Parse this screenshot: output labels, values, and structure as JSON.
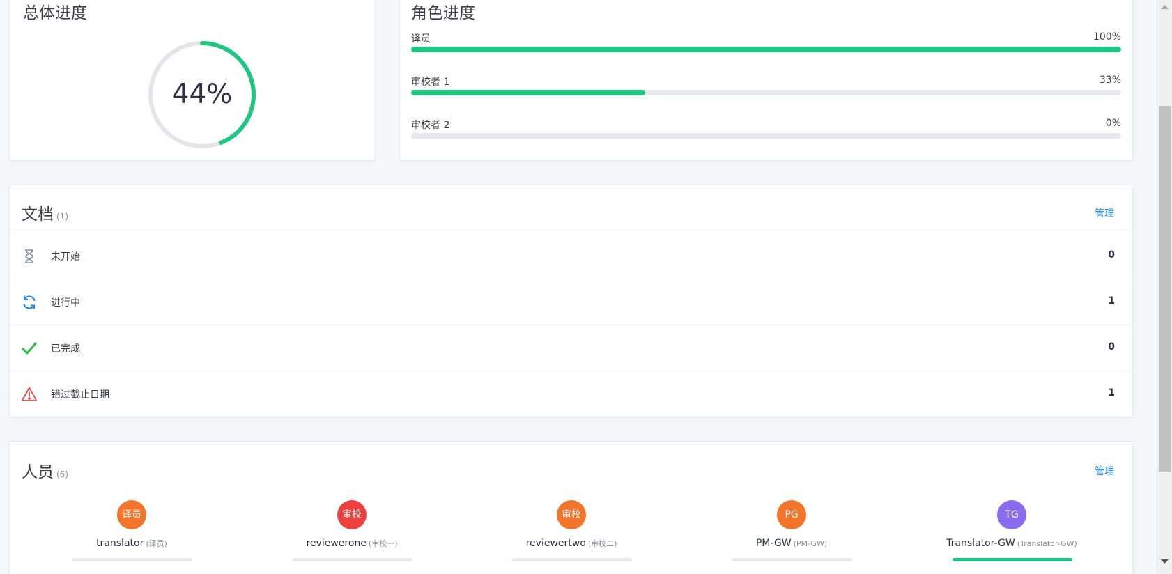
{
  "overall": {
    "title": "总体进度",
    "percent_text": "44%",
    "percent": 44,
    "ring_color": "#1ec780",
    "track_color": "#e4e5ea"
  },
  "roles": {
    "title": "角色进度",
    "items": [
      {
        "name": "译员",
        "percent_text": "100%",
        "percent": 100
      },
      {
        "name": "审校者 1",
        "percent_text": "33%",
        "percent": 33
      },
      {
        "name": "审校者 2",
        "percent_text": "0%",
        "percent": 0
      }
    ],
    "bar_color": "#1ec780"
  },
  "documents": {
    "title": "文档",
    "count": "(1)",
    "manage_label": "管理",
    "rows": [
      {
        "icon": "hourglass-icon",
        "label": "未开始",
        "count": "0"
      },
      {
        "icon": "sync-icon",
        "label": "进行中",
        "count": "1"
      },
      {
        "icon": "check-icon",
        "label": "已完成",
        "count": "0"
      },
      {
        "icon": "warning-icon",
        "label": "错过截止日期",
        "count": "1"
      }
    ]
  },
  "people": {
    "title": "人员",
    "count": "(6)",
    "manage_label": "管理",
    "members": [
      {
        "initials": "译员",
        "name": "translator",
        "role": "(译员)",
        "color": "#f3742b",
        "progress": 0
      },
      {
        "initials": "审校",
        "name": "reviewerone",
        "role": "(审校一)",
        "color": "#ef4040",
        "progress": 0
      },
      {
        "initials": "审校",
        "name": "reviewertwo",
        "role": "(审校二)",
        "color": "#f3742b",
        "progress": 0
      },
      {
        "initials": "PG",
        "name": "PM-GW",
        "role": "(PM-GW)",
        "color": "#f3742b",
        "progress": 0
      },
      {
        "initials": "TG",
        "name": "Translator-GW",
        "role": "(Translator-GW)",
        "color": "#8b6cf0",
        "progress": 100
      }
    ]
  },
  "colors": {
    "link": "#1d87e4",
    "success": "#1ec780",
    "danger": "#e64545",
    "sync": "#1d87e4",
    "hourglass": "#8a8d99"
  }
}
